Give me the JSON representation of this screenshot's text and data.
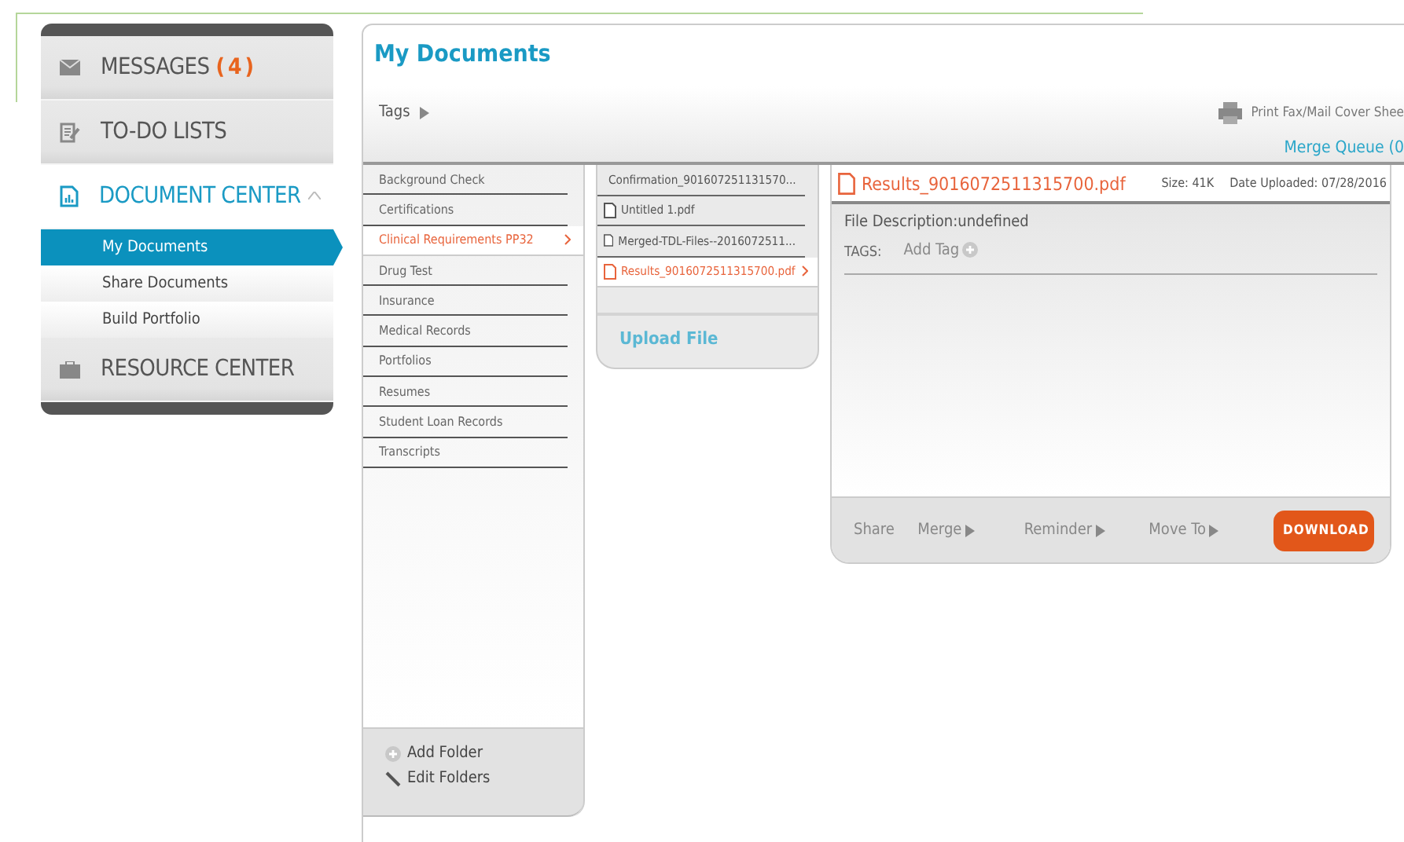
{
  "sidebar": {
    "sections": [
      {
        "kind": "messages",
        "label": "MESSAGES",
        "badge": "(4)",
        "active": false
      },
      {
        "kind": "todo",
        "label": "TO-DO LISTS",
        "active": false
      },
      {
        "kind": "documents",
        "label": "DOCUMENT CENTER",
        "active": true,
        "expanded": true,
        "children": [
          {
            "label": "My Documents",
            "selected": true
          },
          {
            "label": "Share Documents",
            "selected": false
          },
          {
            "label": "Build Portfolio",
            "selected": false
          }
        ]
      },
      {
        "kind": "resources",
        "label": "RESOURCE CENTER",
        "active": false
      }
    ]
  },
  "page": {
    "title": "My Documents",
    "tags_label": "Tags",
    "print_label": "Print Fax/Mail Cover Shee",
    "merge_queue": "Merge Queue (0"
  },
  "folders": [
    {
      "label": "Background Check",
      "selected": false
    },
    {
      "label": "Certifications",
      "selected": false
    },
    {
      "label": "Clinical Requirements PP32",
      "selected": true
    },
    {
      "label": "Drug Test",
      "selected": false
    },
    {
      "label": "Insurance",
      "selected": false
    },
    {
      "label": "Medical Records",
      "selected": false
    },
    {
      "label": "Portfolios",
      "selected": false
    },
    {
      "label": "Resumes",
      "selected": false
    },
    {
      "label": "Student Loan Records",
      "selected": false
    },
    {
      "label": "Transcripts",
      "selected": false
    }
  ],
  "folder_actions": [
    {
      "kind": "add",
      "label": "Add Folder"
    },
    {
      "kind": "edit",
      "label": "Edit Folders"
    }
  ],
  "files": [
    {
      "label": "Confirmation_901607251131570...",
      "selected": false
    },
    {
      "label": "Untitled 1.pdf",
      "selected": false
    },
    {
      "label": "Merged-TDL-Files--2016072511...",
      "selected": false
    },
    {
      "label": "Results_9016072511315700.pdf",
      "selected": true
    }
  ],
  "upload_label": "Upload File",
  "detail": {
    "name": "Results_9016072511315700.pdf",
    "size": "Size: 41K",
    "date": "Date Uploaded: 07/28/2016",
    "description": "File Description:undefined",
    "tags_label": "TAGS:",
    "add_tag": "Add Tag",
    "actions": [
      {
        "kind": "link",
        "label": "Share"
      },
      {
        "kind": "menu",
        "label": "Merge"
      },
      {
        "kind": "menu",
        "label": "Reminder"
      },
      {
        "kind": "menu",
        "label": "Move To"
      },
      {
        "kind": "primary",
        "label": "DOWNLOAD"
      }
    ]
  }
}
